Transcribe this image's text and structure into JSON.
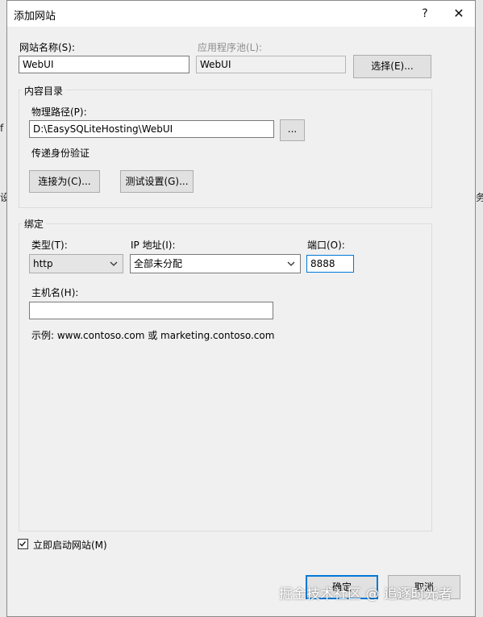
{
  "dialog": {
    "title": "添加网站",
    "help_glyph": "?",
    "close_glyph": "✕"
  },
  "site_name": {
    "label": "网站名称(S):",
    "value": "WebUI"
  },
  "app_pool": {
    "label": "应用程序池(L):",
    "value": "WebUI",
    "select_button": "选择(E)..."
  },
  "content": {
    "group_title": "内容目录",
    "path_label": "物理路径(P):",
    "path_value": "D:\\EasySQLiteHosting\\WebUI",
    "browse_button": "...",
    "auth_label": "传递身份验证",
    "connect_as_button": "连接为(C)...",
    "test_settings_button": "测试设置(G)..."
  },
  "binding": {
    "group_title": "绑定",
    "type_label": "类型(T):",
    "type_value": "http",
    "ip_label": "IP 地址(I):",
    "ip_value": "全部未分配",
    "port_label": "端口(O):",
    "port_value": "8888",
    "host_label": "主机名(H):",
    "host_value": "",
    "example": "示例: www.contoso.com 或 marketing.contoso.com"
  },
  "start_immediately": {
    "label": "立即启动网站(M)",
    "checked": true
  },
  "footer": {
    "ok_button": "确定",
    "cancel_button": "取消"
  },
  "background_fragments": {
    "left_top": "f",
    "left_mid": "设",
    "right_mid": "务"
  },
  "watermark": "掘金技术社区 @ 追逐时光者",
  "colors": {
    "dialog_bg": "#f0f0f0",
    "accent": "#0078d7"
  },
  "icons": [
    "help-icon",
    "close-icon",
    "chevron-down-icon",
    "checkmark-icon"
  ]
}
